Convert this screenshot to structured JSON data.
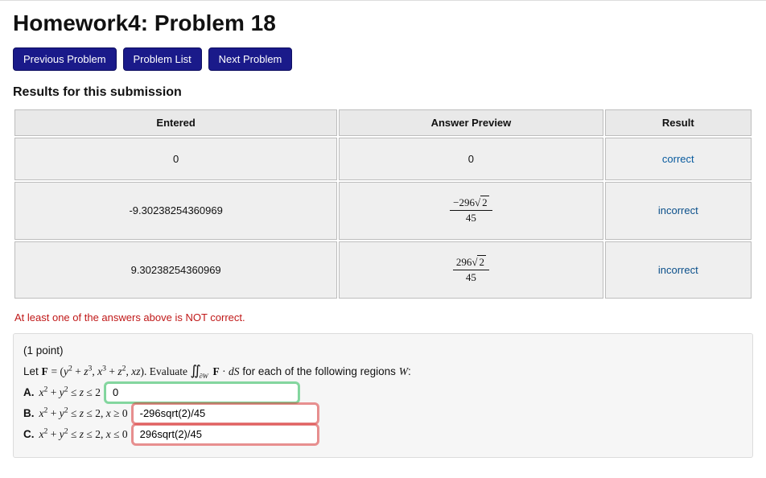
{
  "header": {
    "title": "Homework4: Problem 18"
  },
  "nav": {
    "prev": "Previous Problem",
    "list": "Problem List",
    "next": "Next Problem"
  },
  "results": {
    "heading": "Results for this submission",
    "columns": {
      "entered": "Entered",
      "preview": "Answer Preview",
      "result": "Result"
    },
    "rows": [
      {
        "entered": "0",
        "preview_plain": "0",
        "preview_frac": null,
        "result": "correct",
        "result_kind": "correct"
      },
      {
        "entered": "-9.30238254360969",
        "preview_plain": null,
        "preview_frac": {
          "num_lead": "−296",
          "num_rad": "2",
          "den": "45"
        },
        "result": "incorrect",
        "result_kind": "incorrect"
      },
      {
        "entered": "9.30238254360969",
        "preview_plain": null,
        "preview_frac": {
          "num_lead": "296",
          "num_rad": "2",
          "den": "45"
        },
        "result": "incorrect",
        "result_kind": "incorrect"
      }
    ],
    "warning": "At least one of the answers above is NOT correct."
  },
  "problem": {
    "points": "(1 point)",
    "let_prefix": "Let ",
    "F_label": "F",
    "F_def_open": " = (",
    "F_t1_a": "y",
    "F_t1_ae": "2",
    "F_t1_plus": " + ",
    "F_t1_b": "z",
    "F_t1_be": "3",
    "F_sep1": ", ",
    "F_t2_a": "x",
    "F_t2_ae": "3",
    "F_t2_plus": " + ",
    "F_t2_b": "z",
    "F_t2_be": "2",
    "F_sep2": ", ",
    "F_t3": "xz",
    "F_def_close": "). Evaluate ",
    "int_sym": "∬",
    "int_sub": "∂W",
    "int_integrand_F": " F",
    "int_dot": " · ",
    "int_dS": "dS",
    "tail": " for each of the following regions ",
    "W_label": "W",
    "colon": ":",
    "parts": {
      "A": {
        "label": "A.",
        "lhs_a": "x",
        "lhs_ae": "2",
        "plus": " + ",
        "lhs_b": "y",
        "lhs_be": "2",
        "rel1": " ≤ ",
        "mid": "z",
        "rel2": " ≤ ",
        "rhs": "2",
        "value": "0",
        "status": "correct"
      },
      "B": {
        "label": "B.",
        "lhs_a": "x",
        "lhs_ae": "2",
        "plus": " + ",
        "lhs_b": "y",
        "lhs_be": "2",
        "rel1": " ≤ ",
        "mid": "z",
        "rel2": " ≤ ",
        "rhs": "2, ",
        "extra_var": "x",
        "extra_rel": " ≥ ",
        "extra_val": "0",
        "value": "-296sqrt(2)/45",
        "status": "incorrect"
      },
      "C": {
        "label": "C.",
        "lhs_a": "x",
        "lhs_ae": "2",
        "plus": " + ",
        "lhs_b": "y",
        "lhs_be": "2",
        "rel1": " ≤ ",
        "mid": "z",
        "rel2": " ≤ ",
        "rhs": "2, ",
        "extra_var": "x",
        "extra_rel": " ≤ ",
        "extra_val": "0",
        "value": "296sqrt(2)/45",
        "status": "incorrect"
      }
    }
  }
}
